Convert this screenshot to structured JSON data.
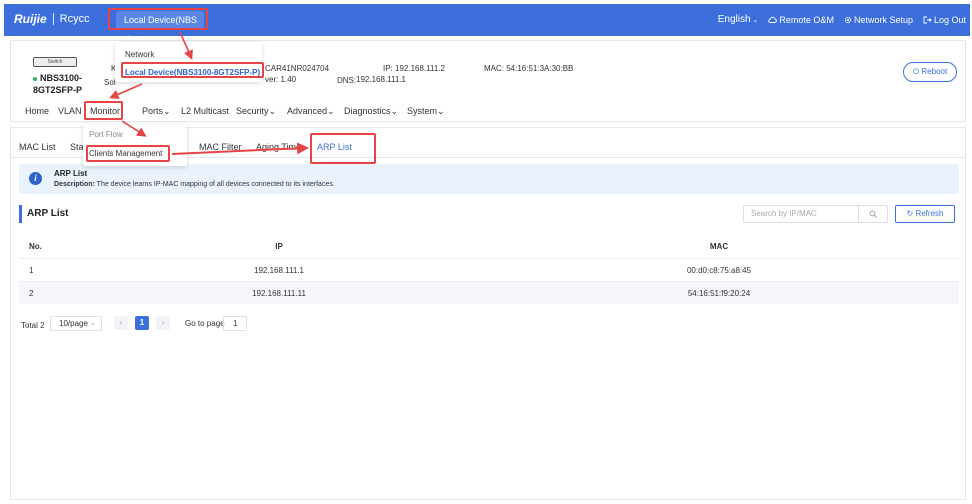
{
  "header": {
    "logo": "Ruijie",
    "logo_sub": "Rcycc",
    "device_button": "Local Device(NBS",
    "language": "English",
    "remote": "Remote O&M",
    "network_setup": "Network Setup",
    "logout": "Log Out"
  },
  "device": {
    "image_label": "Switch",
    "name_line1": "NBS3100-",
    "name_line2": "8GT2SFP-P",
    "k_label": "K",
    "sof_label": "Sof",
    "sn": "CAR41NR024704",
    "ip": "IP: 192.168.111.2",
    "mac": "MAC: 54:16:51:3A:30:BB",
    "ver": "ver: 1.40",
    "dns_label": "DNS:",
    "dns": "192.168.111.1",
    "reboot": "Reboot"
  },
  "nav": {
    "home": "Home",
    "vlan": "VLAN",
    "monitor": "Monitor",
    "ports": "Ports",
    "l2multicast": "L2 Multicast",
    "security": "Security",
    "advanced": "Advanced",
    "diagnostics": "Diagnostics",
    "system": "System"
  },
  "device_dropdown": {
    "network": "Network",
    "local_device": "Local Device(NBS3100-8GT2SFP-P)"
  },
  "monitor_dropdown": {
    "port_flow": "Port Flow",
    "clients_management": "Clients Management"
  },
  "subtabs": {
    "mac_list": "MAC List",
    "stat": "Stat",
    "mac_filter": "MAC Filter",
    "aging_time": "Aging Time",
    "arp_list": "ARP List"
  },
  "notice": {
    "title": "ARP List",
    "desc_label": "Description:",
    "desc": "The device learns IP-MAC mapping of all devices connected to its interfaces."
  },
  "section": {
    "title": "ARP List",
    "search_placeholder": "Search by IP/MAC",
    "refresh": "Refresh"
  },
  "table": {
    "headers": [
      "No.",
      "IP",
      "MAC"
    ],
    "rows": [
      [
        "1",
        "192.168.111.1",
        "00:d0:c8:75:a8:45"
      ],
      [
        "2",
        "192.168.111.11",
        "54:16:51:f9:20:24"
      ]
    ]
  },
  "pager": {
    "total": "Total 2",
    "page_size": "10/page",
    "current": "1",
    "goto_label": "Go to page",
    "goto_value": "1"
  },
  "colors": {
    "accent": "#3d6fdc",
    "highlight": "#e74545"
  }
}
